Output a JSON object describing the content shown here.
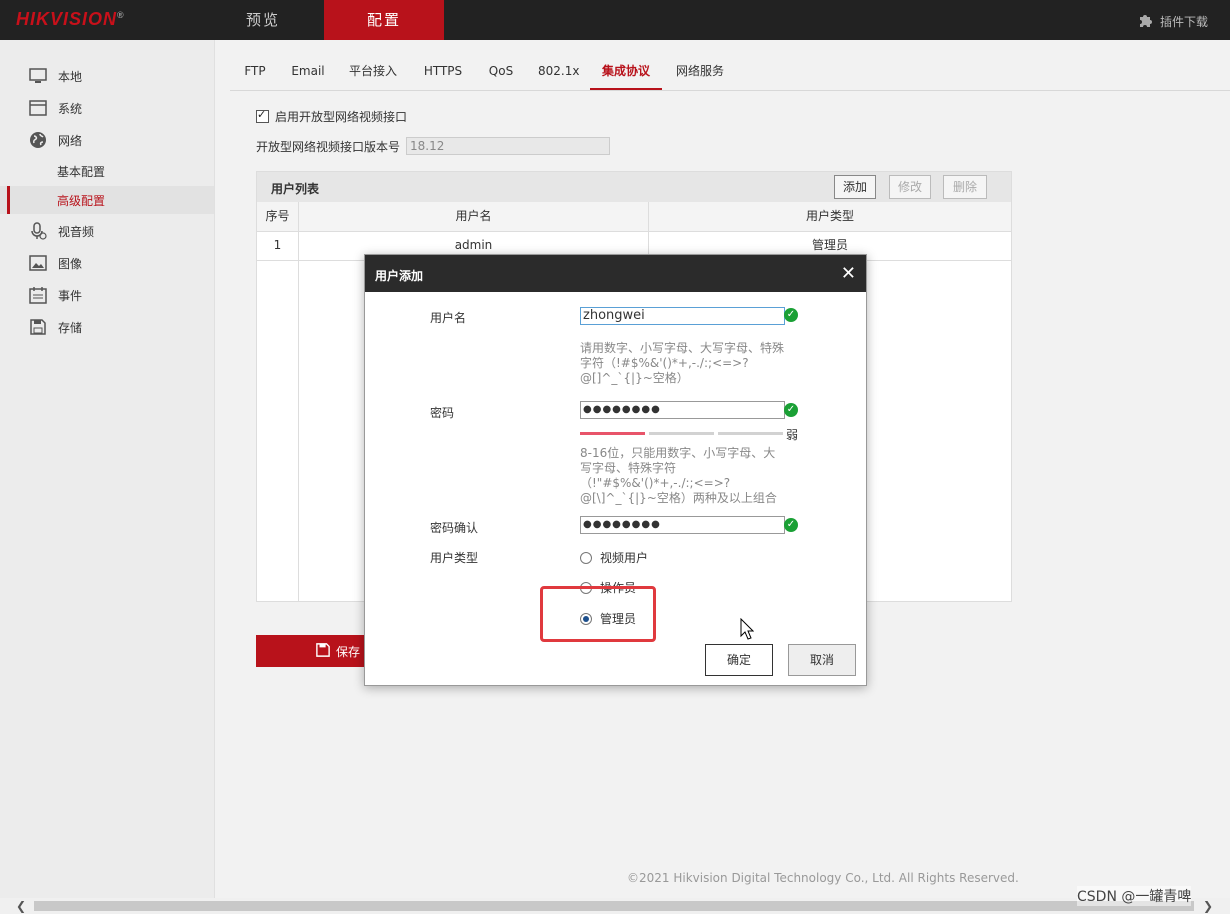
{
  "header": {
    "logo": "HIKVISION",
    "logo_reg": "®",
    "tabs": [
      {
        "label": "预览"
      },
      {
        "label": "配置"
      }
    ],
    "plugin_label": "插件下载"
  },
  "sidebar": {
    "items": [
      {
        "label": "本地"
      },
      {
        "label": "系统"
      },
      {
        "label": "网络"
      },
      {
        "label": "基本配置"
      },
      {
        "label": "高级配置"
      },
      {
        "label": "视音频"
      },
      {
        "label": "图像"
      },
      {
        "label": "事件"
      },
      {
        "label": "存储"
      }
    ]
  },
  "subtabs": [
    {
      "label": "FTP"
    },
    {
      "label": "Email"
    },
    {
      "label": "平台接入"
    },
    {
      "label": "HTTPS"
    },
    {
      "label": "QoS"
    },
    {
      "label": "802.1x"
    },
    {
      "label": "集成协议"
    },
    {
      "label": "网络服务"
    }
  ],
  "content": {
    "enable_label": "启用开放型网络视频接口",
    "version_label": "开放型网络视频接口版本号",
    "version_value": "18.12",
    "userlist": {
      "title": "用户列表",
      "add": "添加",
      "edit": "修改",
      "delete": "删除",
      "columns": [
        "序号",
        "用户名",
        "用户类型"
      ],
      "rows": [
        {
          "index": "1",
          "username": "admin",
          "type": "管理员"
        }
      ]
    },
    "save_label": "保存"
  },
  "dialog": {
    "title": "用户添加",
    "close": "✕",
    "username_label": "用户名",
    "username_value": "zhongwei",
    "username_hint": "请用数字、小写字母、大写字母、特殊字符（!#$%&'()*+,-./:;<=>?@[]^_`{|}~空格）",
    "password_label": "密码",
    "password_value": "●●●●●●●●",
    "strength_label": "弱",
    "password_hint": "8-16位，只能用数字、小写字母、大写字母、特殊字符（!\"#$%&'()*+,-./:;<=>?@[\\]^_`{|}~空格）两种及以上组合",
    "confirm_label": "密码确认",
    "confirm_value": "●●●●●●●●",
    "usertype_label": "用户类型",
    "usertype_options": [
      {
        "label": "视频用户",
        "selected": false
      },
      {
        "label": "操作员",
        "selected": false
      },
      {
        "label": "管理员",
        "selected": true
      }
    ],
    "ok_label": "确定",
    "cancel_label": "取消"
  },
  "footer": {
    "copyright": "©2021 Hikvision Digital Technology Co., Ltd. All Rights Reserved.",
    "watermark": "CSDN @一罐青啤"
  },
  "colors": {
    "brand_red": "#b8121b",
    "ok_green": "#1aa035",
    "highlight_red": "#e0393e",
    "strength_weak": "#e8546a"
  }
}
